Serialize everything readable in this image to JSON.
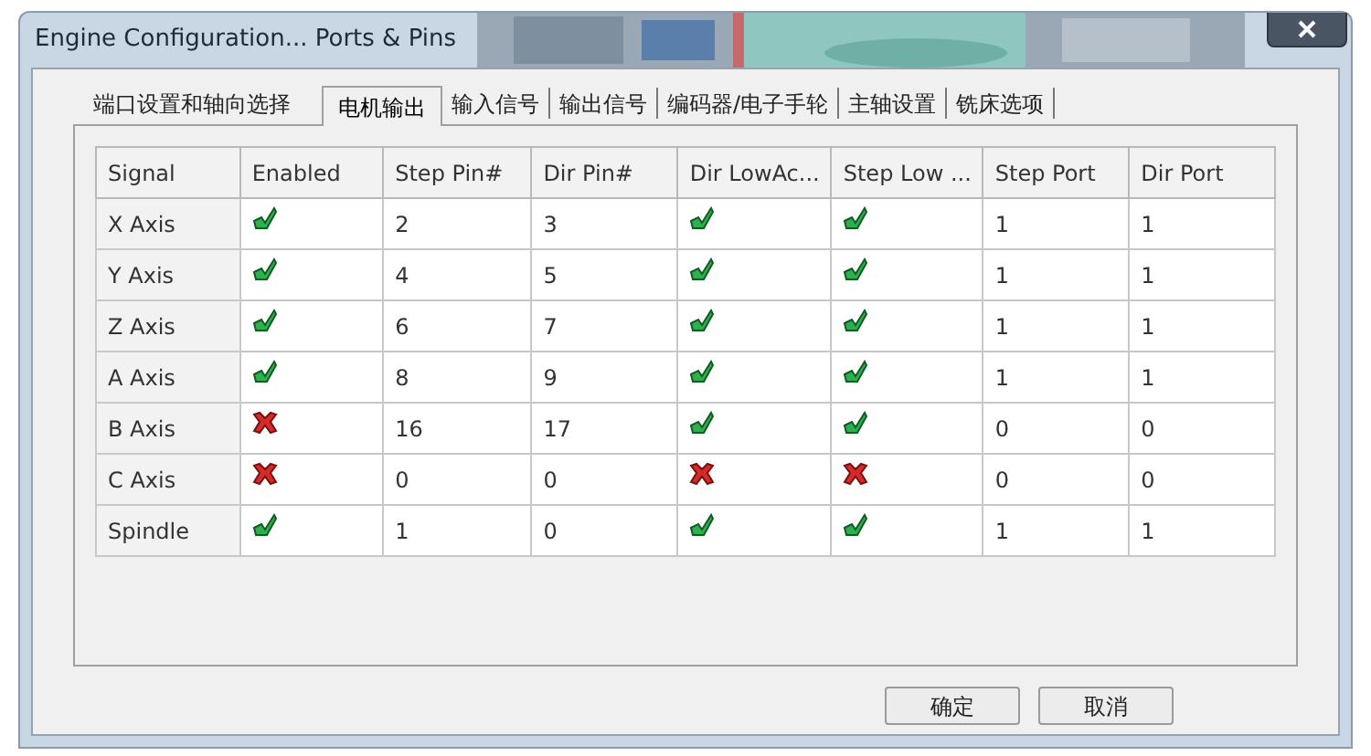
{
  "window": {
    "title": "Engine Configuration... Ports & Pins"
  },
  "tabs": [
    {
      "label": "端口设置和轴向选择",
      "selected": false
    },
    {
      "label": "电机输出",
      "selected": true
    },
    {
      "label": "输入信号",
      "selected": false
    },
    {
      "label": "输出信号",
      "selected": false
    },
    {
      "label": "编码器/电子手轮",
      "selected": false
    },
    {
      "label": "主轴设置",
      "selected": false
    },
    {
      "label": "铣床选项",
      "selected": false
    }
  ],
  "table": {
    "columns": [
      "Signal",
      "Enabled",
      "Step Pin#",
      "Dir Pin#",
      "Dir LowAc...",
      "Step Low ...",
      "Step Port",
      "Dir Port"
    ],
    "rows": [
      {
        "signal": "X Axis",
        "enabled": true,
        "step_pin": "2",
        "dir_pin": "3",
        "dir_low_active": true,
        "step_low_active": true,
        "step_port": "1",
        "dir_port": "1"
      },
      {
        "signal": "Y Axis",
        "enabled": true,
        "step_pin": "4",
        "dir_pin": "5",
        "dir_low_active": true,
        "step_low_active": true,
        "step_port": "1",
        "dir_port": "1"
      },
      {
        "signal": "Z Axis",
        "enabled": true,
        "step_pin": "6",
        "dir_pin": "7",
        "dir_low_active": true,
        "step_low_active": true,
        "step_port": "1",
        "dir_port": "1"
      },
      {
        "signal": "A Axis",
        "enabled": true,
        "step_pin": "8",
        "dir_pin": "9",
        "dir_low_active": true,
        "step_low_active": true,
        "step_port": "1",
        "dir_port": "1"
      },
      {
        "signal": "B Axis",
        "enabled": false,
        "step_pin": "16",
        "dir_pin": "17",
        "dir_low_active": true,
        "step_low_active": true,
        "step_port": "0",
        "dir_port": "0"
      },
      {
        "signal": "C Axis",
        "enabled": false,
        "step_pin": "0",
        "dir_pin": "0",
        "dir_low_active": false,
        "step_low_active": false,
        "step_port": "0",
        "dir_port": "0"
      },
      {
        "signal": "Spindle",
        "enabled": true,
        "step_pin": "1",
        "dir_pin": "0",
        "dir_low_active": true,
        "step_low_active": true,
        "step_port": "1",
        "dir_port": "1"
      }
    ]
  },
  "buttons": [
    "确定",
    "取消"
  ]
}
